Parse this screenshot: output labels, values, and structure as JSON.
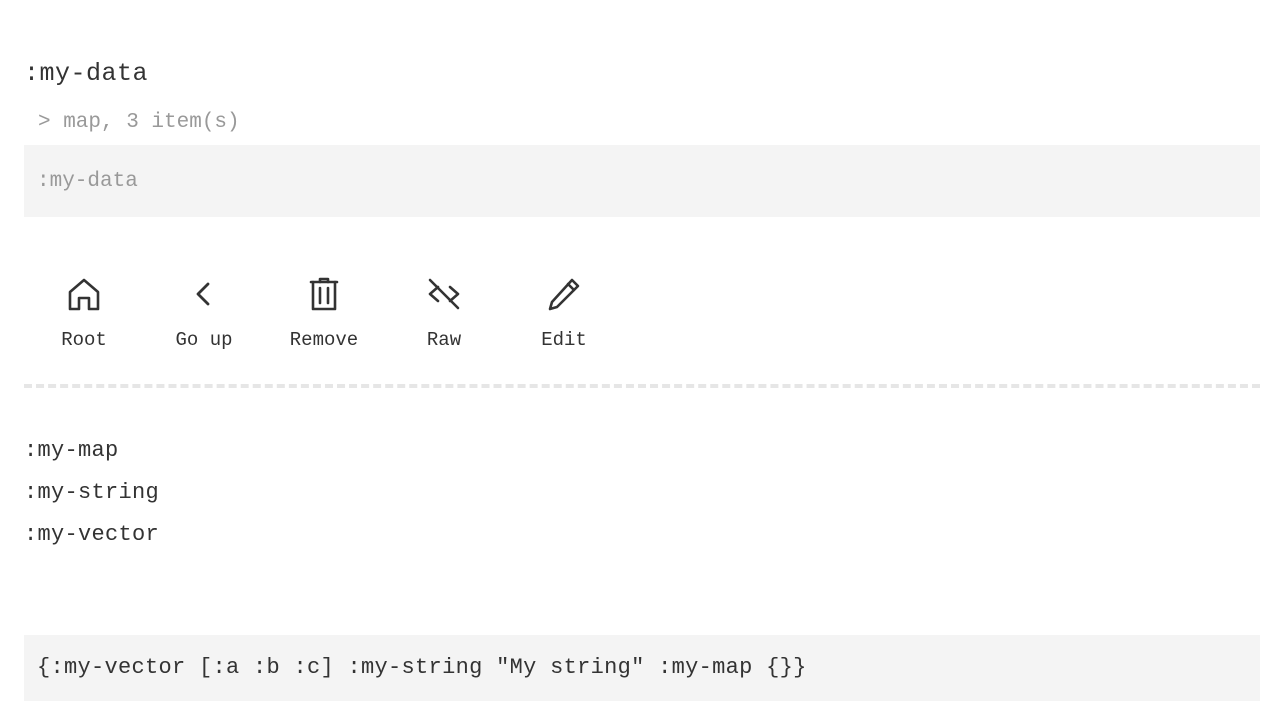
{
  "header": {
    "title": ":my-data",
    "meta": "> map, 3 item(s)"
  },
  "path": {
    "value": ":my-data"
  },
  "toolbar": {
    "items": [
      {
        "label": "Root",
        "icon": "home-icon"
      },
      {
        "label": "Go up",
        "icon": "chevron-left-icon"
      },
      {
        "label": "Remove",
        "icon": "trash-icon"
      },
      {
        "label": "Raw",
        "icon": "code-off-icon"
      },
      {
        "label": "Edit",
        "icon": "pencil-icon"
      }
    ]
  },
  "keys": [
    ":my-map",
    ":my-string",
    ":my-vector"
  ],
  "raw": {
    "value": "{:my-vector [:a :b :c] :my-string \"My string\" :my-map {}}"
  },
  "colors": {
    "text": "#333333",
    "muted": "#999999",
    "panel_bg": "#f4f4f4",
    "divider": "#e6e6e6"
  }
}
